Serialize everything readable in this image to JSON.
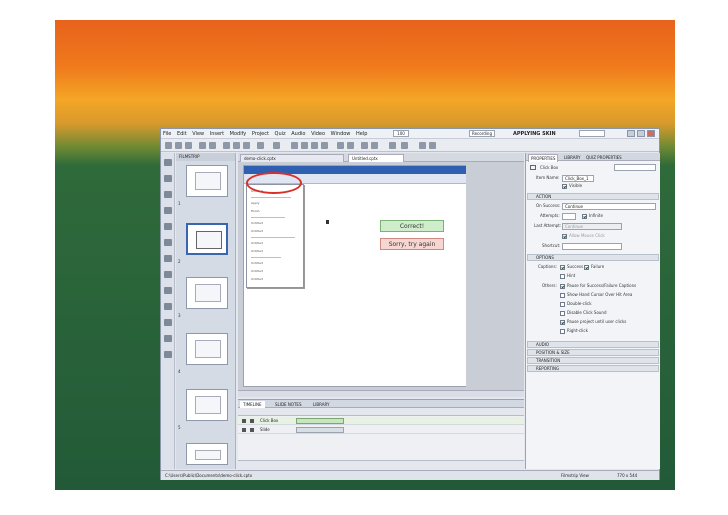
{
  "menu": [
    "File",
    "Edit",
    "View",
    "Insert",
    "Modify",
    "Project",
    "Quiz",
    "Audio",
    "Video",
    "Window",
    "Help"
  ],
  "zoom": "100",
  "mode": "Recording",
  "workspace": "APPLYING SKIN",
  "filmstrip": {
    "header": "FILMSTRIP",
    "slide_numbers": [
      "1",
      "2",
      "3",
      "4",
      "5"
    ]
  },
  "stage": {
    "tabs": [
      "demo-click.cptx",
      "Untitled.cptx"
    ],
    "capture_menu": [
      "Untitled",
      "Apply",
      "Finish",
      "Untitled",
      "Untitled",
      "Untitled",
      "Untitled",
      "Untitled",
      "Untitled",
      "Untitled"
    ],
    "correct_label": "Correct!",
    "sorry_label": "Sorry, try again"
  },
  "timeline": {
    "tabs": [
      "TIMELINE",
      "SLIDE NOTES",
      "LIBRARY"
    ],
    "rows": [
      {
        "name": "Click Box",
        "selected": true
      },
      {
        "name": "Slide"
      }
    ]
  },
  "properties": {
    "tabs": [
      "PROPERTIES",
      "LIBRARY",
      "QUIZ PROPERTIES"
    ],
    "object_type": "Click Box",
    "item_name_label": "Item Name:",
    "item_name_value": "Click_Box_1",
    "visible_label": "Visible",
    "sections": {
      "action": "ACTION",
      "options": "OPTIONS",
      "audio": "AUDIO",
      "position_size": "POSITION & SIZE",
      "transition": "TRANSITION",
      "reporting": "REPORTING"
    },
    "on_success_label": "On Success:",
    "on_success_value": "Continue",
    "attempts_label": "Attempts:",
    "infinite_label": "Infinite",
    "last_attempt_label": "Last Attempt:",
    "last_attempt_value": "Continue",
    "allow_mouse_label": "Allow Mouse Click",
    "shortcut_label": "Shortcut:",
    "captions_label": "Captions:",
    "success_label": "Success",
    "failure_label": "Failure",
    "hint_label": "Hint",
    "others_label": "Others:",
    "pause_label": "Pause for Success/Failure Captions",
    "hand_cursor_label": "Show Hand Cursor Over Hit Area",
    "double_click_label": "Double-click",
    "disable_sound_label": "Disable Click Sound",
    "pause_project_label": "Pause project until user clicks",
    "right_click_label": "Right-click"
  },
  "status": {
    "path": "C:\\Users\\Public\\Documents\\demo-click.cptx",
    "view": "Filmstrip View",
    "size": "770 x 544"
  }
}
